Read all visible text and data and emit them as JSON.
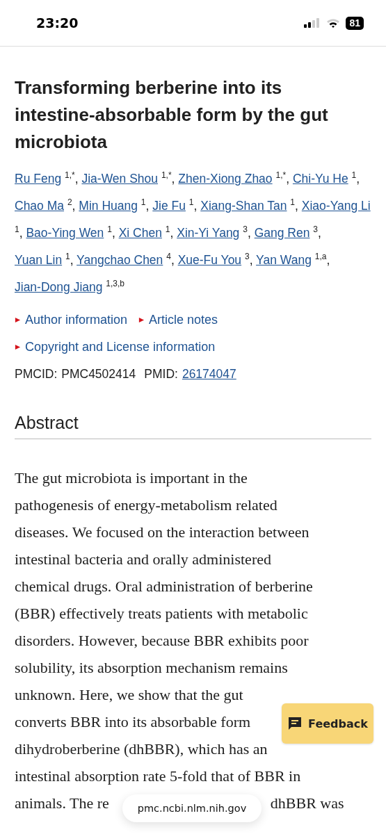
{
  "status_bar": {
    "time": "23:20",
    "battery": "81"
  },
  "article": {
    "title": "Transforming berberine into its intestine-absorbable form by the gut microbiota",
    "authors": [
      {
        "name": "Ru Feng",
        "affiliations": "1,*",
        "separator": ","
      },
      {
        "name": "Jia-Wen Shou",
        "affiliations": "1,*",
        "separator": ","
      },
      {
        "name": "Zhen-Xiong Zhao",
        "affiliations": "1,*",
        "separator": ","
      },
      {
        "name": "Chi-Yu He",
        "affiliations": "1",
        "separator": ","
      },
      {
        "name": "Chao Ma",
        "affiliations": "2",
        "separator": ","
      },
      {
        "name": "Min Huang",
        "affiliations": "1",
        "separator": ","
      },
      {
        "name": "Jie Fu",
        "affiliations": "1",
        "separator": ","
      },
      {
        "name": "Xiang-Shan Tan",
        "affiliations": "1",
        "separator": ","
      },
      {
        "name": "Xiao-Yang Li",
        "affiliations": "1",
        "separator": ","
      },
      {
        "name": "Bao-Ying Wen",
        "affiliations": "1",
        "separator": ","
      },
      {
        "name": "Xi Chen",
        "affiliations": "1",
        "separator": ","
      },
      {
        "name": "Xin-Yi Yang",
        "affiliations": "3",
        "separator": ","
      },
      {
        "name": "Gang Ren",
        "affiliations": "3",
        "separator": ","
      },
      {
        "name": "Yuan Lin",
        "affiliations": "1",
        "separator": ","
      },
      {
        "name": "Yangchao Chen",
        "affiliations": "4",
        "separator": ","
      },
      {
        "name": "Xue-Fu You",
        "affiliations": "3",
        "separator": ","
      },
      {
        "name": "Yan Wang",
        "affiliations": "1,a",
        "separator": ","
      },
      {
        "name": "Jian-Dong Jiang",
        "affiliations": "1,3,b"
      }
    ],
    "sections": [
      {
        "label": "Author information",
        "expanded": false
      },
      {
        "label": "Article notes",
        "expanded": false
      },
      {
        "label": "Copyright and License information",
        "expanded": false
      }
    ],
    "pmcid_label": "PMCID:",
    "pmcid": "PMC4502414",
    "pmid_label": "PMID:",
    "pmid": "26174047"
  },
  "abstract": {
    "heading": "Abstract",
    "lines": [
      {
        "segments": [
          "The gut microbiota is important in the"
        ]
      },
      {
        "segments": [
          "pathogenesis of energy-metabolism related"
        ]
      },
      {
        "segments": [
          "diseases. We focused on the interaction between"
        ]
      },
      {
        "segments": [
          "intestinal bacteria and orally administered"
        ]
      },
      {
        "segments": [
          "chemical drugs. Oral administration of berberine"
        ]
      },
      {
        "segments": [
          "(BBR) effectively treats patients with metabolic"
        ]
      },
      {
        "segments": [
          "disorders. However, because BBR exhibits poor"
        ]
      },
      {
        "segments": [
          "solubility, its absorption mechanism remains"
        ]
      },
      {
        "segments": [
          "unknown. Here, we show that the gut"
        ]
      },
      {
        "segments": [
          "converts BBR into its absorbable form"
        ]
      },
      {
        "segments": [
          "dihydroberberine (dhBBR), which has an"
        ]
      },
      {
        "segments": [
          "intestinal absorption rate 5-fold that of BBR in"
        ]
      },
      {
        "segments": [
          "animals. The re",
          "dhBBR was"
        ]
      }
    ]
  },
  "feedback_button": {
    "label": "Feedback"
  },
  "url_bar": {
    "address": "pmc.ncbi.nlm.nih.gov"
  }
}
